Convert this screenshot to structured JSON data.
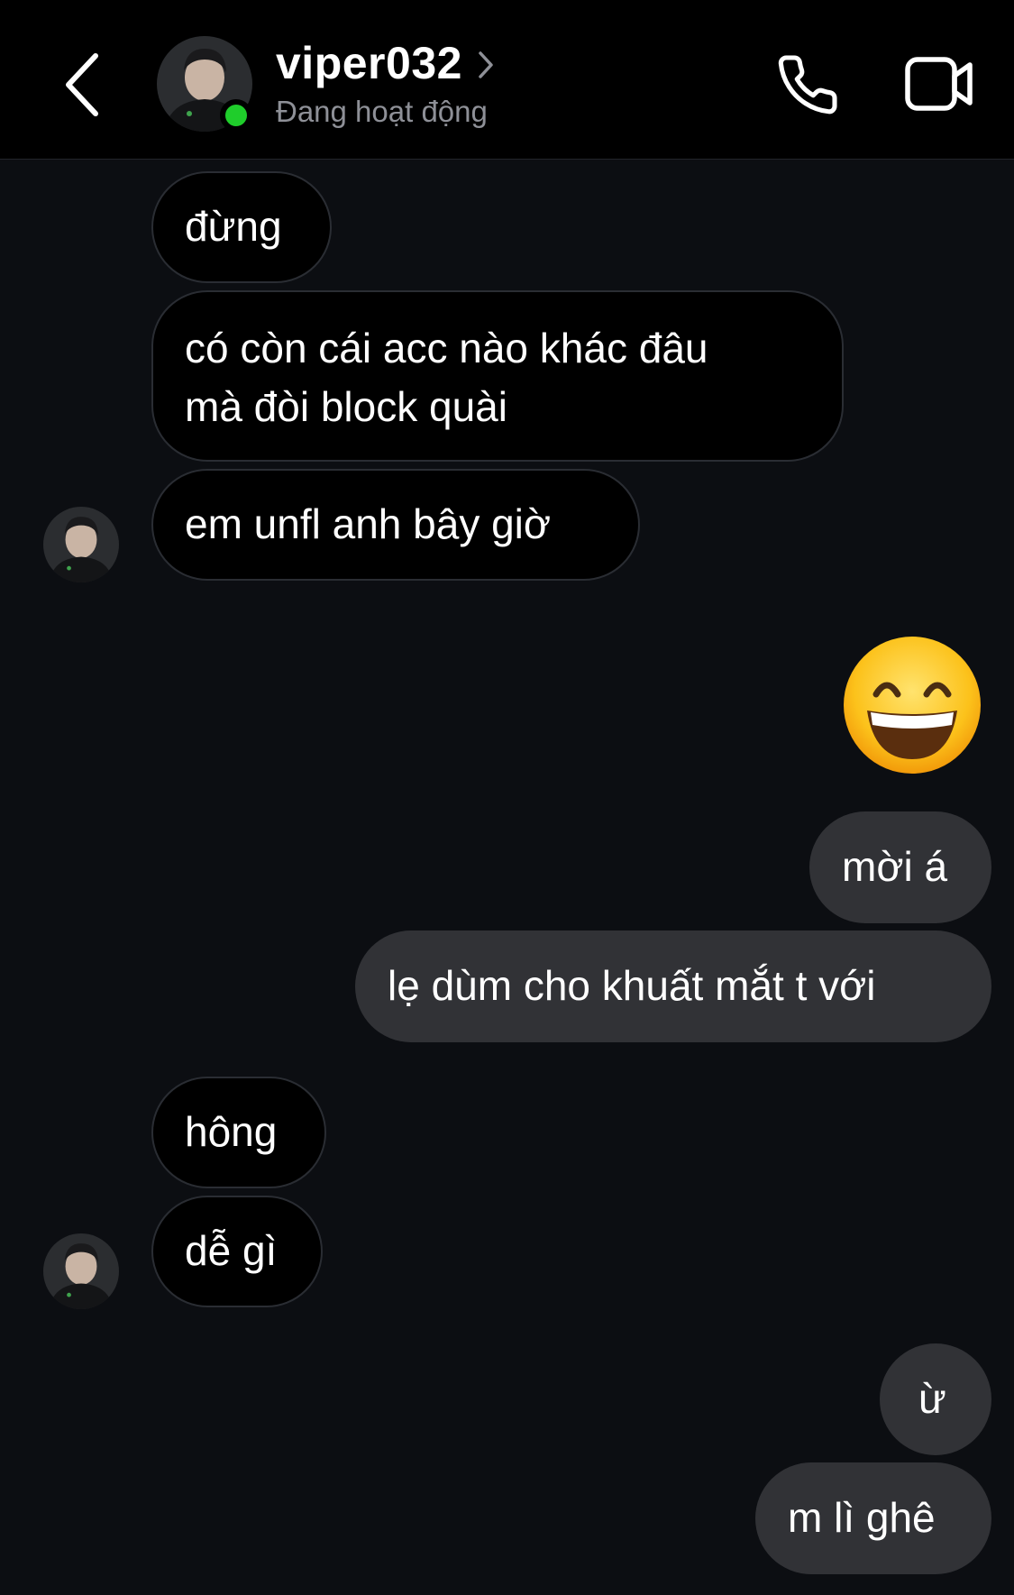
{
  "header": {
    "contact_name": "viper032",
    "status": "Đang hoạt động",
    "icons": {
      "back": "chevron-left-icon",
      "profile": "chevron-right-icon",
      "call": "phone-icon",
      "video": "video-camera-icon"
    },
    "online_color": "#1fcd2b"
  },
  "messages": [
    {
      "from": "them",
      "text": "đừng"
    },
    {
      "from": "them",
      "lines": [
        "có còn cái acc nào khác đâu",
        "mà đòi block quài"
      ]
    },
    {
      "from": "them",
      "text": "em unfl anh bây giờ"
    },
    {
      "from": "me",
      "emoji": "grinning-face-with-smiling-eyes"
    },
    {
      "from": "me",
      "text": "mời á"
    },
    {
      "from": "me",
      "text": "lẹ dùm cho khuất mắt t với"
    },
    {
      "from": "them",
      "text": "hông"
    },
    {
      "from": "them",
      "text": "dễ gì"
    },
    {
      "from": "me",
      "text": "ừ"
    },
    {
      "from": "me",
      "text": "m lì ghê"
    }
  ],
  "colors": {
    "background": "#0c0e12",
    "header_bg": "#000000",
    "incoming_bubble": "#000000",
    "incoming_border": "#2a2d33",
    "outgoing_bubble": "#313236",
    "secondary_text": "#8e9097"
  }
}
